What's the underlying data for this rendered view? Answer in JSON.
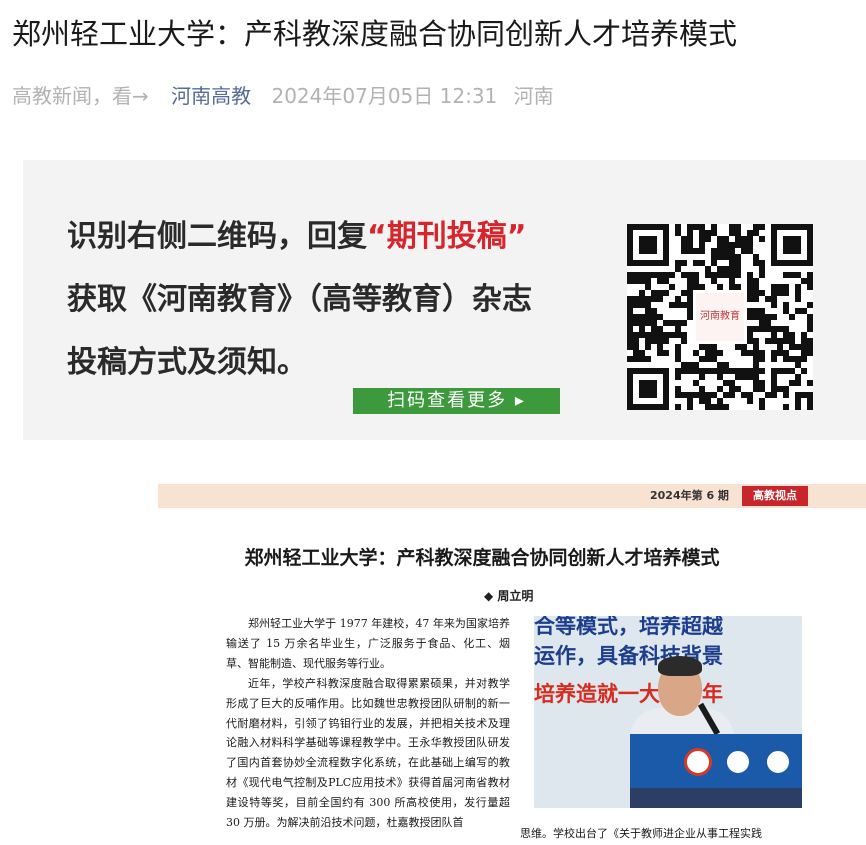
{
  "article": {
    "title": "郑州轻工业大学：产科教深度融合协同创新人才培养模式",
    "meta": {
      "source": "高教新闻，看→",
      "account": "河南高教",
      "datetime": "2024年07月05日 12:31",
      "location": "河南"
    }
  },
  "banner": {
    "line1_prefix": "识别右侧二维码，回复",
    "line1_highlight": "“期刊投稿”",
    "line2": "获取《河南教育》（高等教育）杂志",
    "line3": "投稿方式及须知。",
    "scan_button": "扫码查看更多 ▸",
    "qr_logo_text": "河南教育",
    "accent_color": "#d6252b",
    "button_color": "#3c9a3c"
  },
  "magazine": {
    "issue": "2024年第 6 期",
    "column_tag": "高教视点",
    "title": "郑州轻工业大学：产科教深度融合协同创新人才培养模式",
    "author": "◆ 周立明",
    "paragraphs": [
      "郑州轻工业大学于 1977 年建校，47 年来为国家培养输送了 15 万余名毕业生，广泛服务于食品、化工、烟草、智能制造、现代服务等行业。",
      "近年，学校产科教深度融合取得累累硕果，并对教学形成了巨大的反哺作用。比如魏世忠教授团队研制的新一代耐磨材料，引领了钨钼行业的发展，并把相关技术及理论融入材料科学基础等课程教学中。王永华教授团队研发了国内首套协妙全流程数字化系统，在此基础上编写的教材《现代电气控制及PLC应用技术》获得首届河南省教材建设特等奖，目前全国约有 300 所高校使用，发行量超 30 万册。为解决前沿技术问题，杜嘉教授团队首"
    ],
    "right_bottom_text": "思维。学校出台了《关于教师进企业从事工程实践",
    "photo_banner": [
      "合等模式，培养超越",
      "运作，具备科技背景",
      "培养造就一大批青年"
    ]
  }
}
